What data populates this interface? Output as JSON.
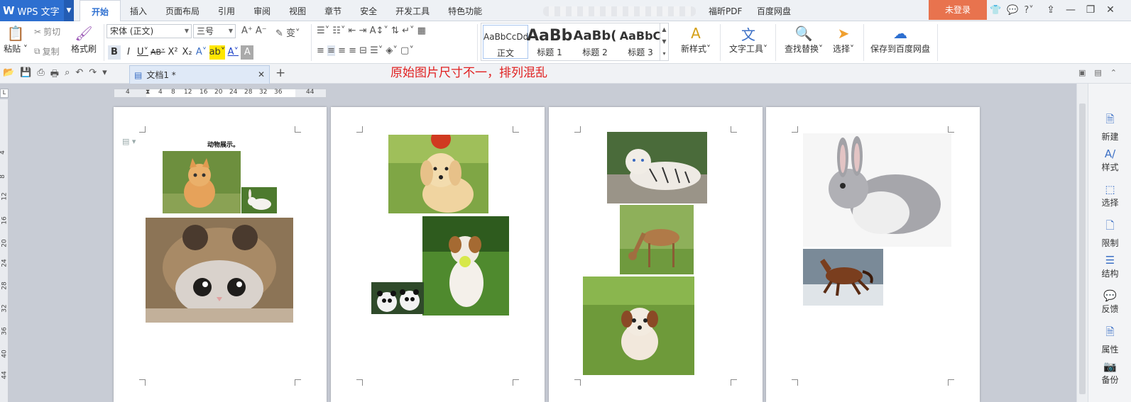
{
  "app": {
    "name": "WPS 文字",
    "logo": "W"
  },
  "menu_tabs": [
    "开始",
    "插入",
    "页面布局",
    "引用",
    "审阅",
    "视图",
    "章节",
    "安全",
    "开发工具",
    "特色功能"
  ],
  "extra_tabs": [
    "福昕PDF",
    "百度网盘"
  ],
  "login_label": "未登录",
  "ribbon": {
    "paste": "粘贴",
    "cut": "剪切",
    "copy": "复制",
    "format_painter": "格式刷",
    "font_name": "宋体 (正文)",
    "font_size": "三号",
    "styles": [
      {
        "sample": "AaBbCcDd",
        "label": "正文"
      },
      {
        "sample": "AaBb",
        "label": "标题 1"
      },
      {
        "sample": "AaBb(",
        "label": "标题 2"
      },
      {
        "sample": "AaBbC",
        "label": "标题 3"
      }
    ],
    "new_style": "新样式",
    "text_tools": "文字工具",
    "find_replace": "查找替换",
    "select": "选择",
    "save_baidu": "保存到百度网盘"
  },
  "document_tab": {
    "name": "文档1 *"
  },
  "annotation": "原始图片尺寸不一，排列混乱",
  "ruler": {
    "h_ticks": [
      "4",
      "2",
      "4",
      "8",
      "12",
      "16",
      "20",
      "24",
      "28",
      "32",
      "36",
      "44"
    ],
    "v_ticks": [
      "4",
      "8",
      "12",
      "16",
      "20",
      "24",
      "28",
      "32",
      "36",
      "40",
      "44"
    ]
  },
  "page1": {
    "title": "动物展示。"
  },
  "pictures": {
    "kitten": "kitten-photo",
    "rabbit_small": "rabbit-photo",
    "cat_hat": "cat-in-hat-photo",
    "puppy_golden": "golden-puppy-photo",
    "dog_ball": "dog-with-ball-photo",
    "pandas": "pandas-photo",
    "tiger": "white-tiger-photo",
    "deer": "deer-photo",
    "puppy_grass": "puppy-in-grass-photo",
    "rabbit_large": "rabbit-photo",
    "horse": "horse-photo"
  },
  "sidepanel": [
    "新建",
    "样式",
    "选择",
    "限制",
    "结构",
    "反馈",
    "属性",
    "备份"
  ],
  "colors": {
    "accent": "#2d6fd0",
    "login": "#e8734e",
    "annotation": "#e02020"
  }
}
